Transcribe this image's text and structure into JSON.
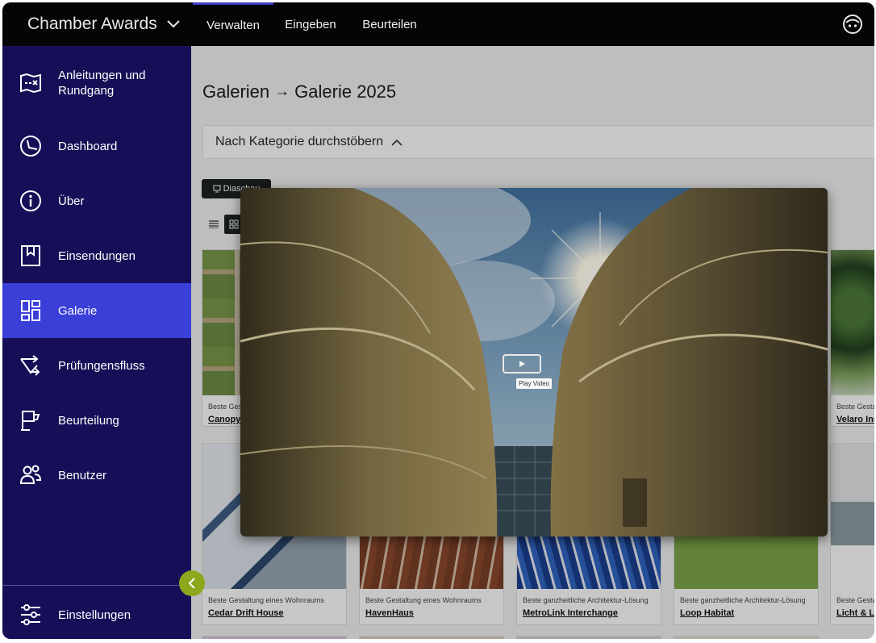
{
  "app": {
    "name": "Chamber Awards"
  },
  "topnav": [
    "Verwalten",
    "Eingeben",
    "Beurteilen"
  ],
  "sidebar": {
    "items": [
      {
        "label": "Anleitungen und Rundgang",
        "icon": "map-icon"
      },
      {
        "label": "Dashboard",
        "icon": "dashboard-icon"
      },
      {
        "label": "Über",
        "icon": "info-icon"
      },
      {
        "label": "Einsendungen",
        "icon": "bookmark-icon"
      },
      {
        "label": "Galerie",
        "icon": "gallery-icon",
        "active": true
      },
      {
        "label": "Prüfungensfluss",
        "icon": "flow-icon"
      },
      {
        "label": "Beurteilung",
        "icon": "flag-icon"
      },
      {
        "label": "Benutzer",
        "icon": "users-icon"
      }
    ],
    "settings_label": "Einstellungen"
  },
  "breadcrumb": {
    "parent": "Galerien",
    "current": "Galerie 2025"
  },
  "browse": {
    "label": "Nach Kategorie durchstöbern"
  },
  "slideshow": {
    "label": "Diaschau"
  },
  "cards": [
    {
      "category": "Beste Gestaltung eines Wohnraums",
      "title": "Canopy Residence"
    },
    {
      "category": "Beste Gestaltung eines Wohnraums",
      "title": "Velaro Innovation"
    },
    {
      "category": "Beste Gestaltung eines Wohnraums",
      "title": "Cedar Drift House"
    },
    {
      "category": "Beste Gestaltung eines Wohnraums",
      "title": "HavenHaus"
    },
    {
      "category": "Beste ganzheitliche Architektur-Lösung",
      "title": "MetroLink Interchange"
    },
    {
      "category": "Beste ganzheitliche Architektur-Lösung",
      "title": "Loop Habitat"
    },
    {
      "category": "Beste Gestaltung eines Wohnraums",
      "title": "Licht & Leben"
    }
  ],
  "lightbox": {
    "play_tooltip": "Play Video"
  },
  "colors": {
    "sidebar": "#160f57",
    "active": "#3a3fd8",
    "topbar": "#050505",
    "collapse": "#8ea81e"
  }
}
